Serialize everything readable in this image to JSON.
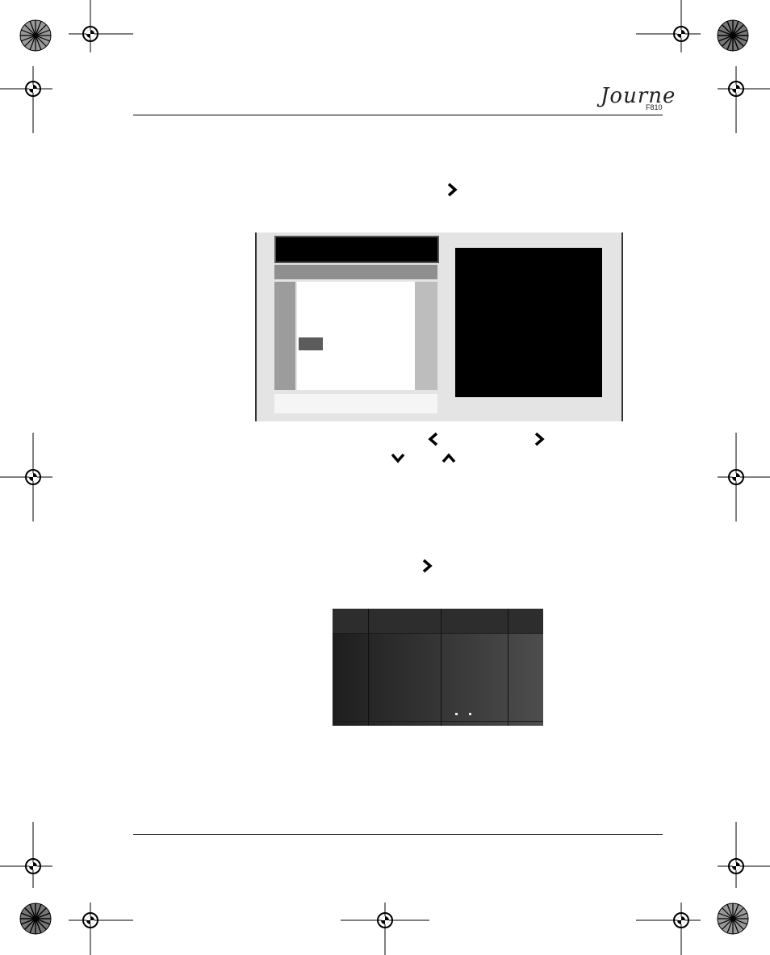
{
  "header": {
    "brand": "Journe",
    "model": "F810"
  },
  "icons": {
    "nav_right": "chevron-right-icon",
    "nav_left": "chevron-left-icon",
    "nav_down": "chevron-down-icon",
    "nav_up": "chevron-up-icon",
    "registration_mark": "crosshair-registration-icon",
    "color_target": "starburst-target-icon"
  },
  "colors": {
    "screen_bg": "#e4e4e4",
    "preview": "#000000",
    "table_dark": "#1e1e1e",
    "table_light": "#4d4d4d"
  }
}
